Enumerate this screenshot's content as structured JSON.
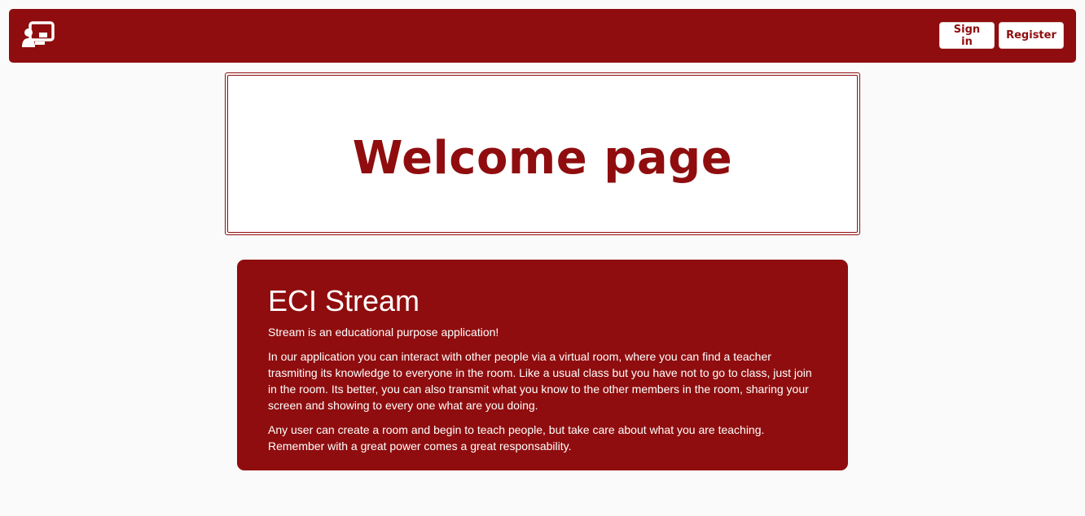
{
  "navbar": {
    "logo_icon": "teacher-presentation-icon",
    "sign_in_label": "Sign in",
    "register_label": "Register"
  },
  "welcome": {
    "title": "Welcome page"
  },
  "about": {
    "title": "ECI Stream",
    "paragraphs": [
      "Stream is an educational purpose application!",
      "In our application you can interact with other people via a virtual room, where you can find a teacher trasmiting its knowledge to everyone in the room. Like a usual class but you have not to go to class, just join in the room. Its better, you can also transmit what you know to the other members in the room, sharing your screen and showing to every one what are you doing.",
      "Any user can create a room and begin to teach people, but take care about what you are teaching. Remember with a great power comes a great responsability."
    ]
  },
  "colors": {
    "brand": "#8f0d0e",
    "background": "#fafafa",
    "surface": "#ffffff"
  }
}
